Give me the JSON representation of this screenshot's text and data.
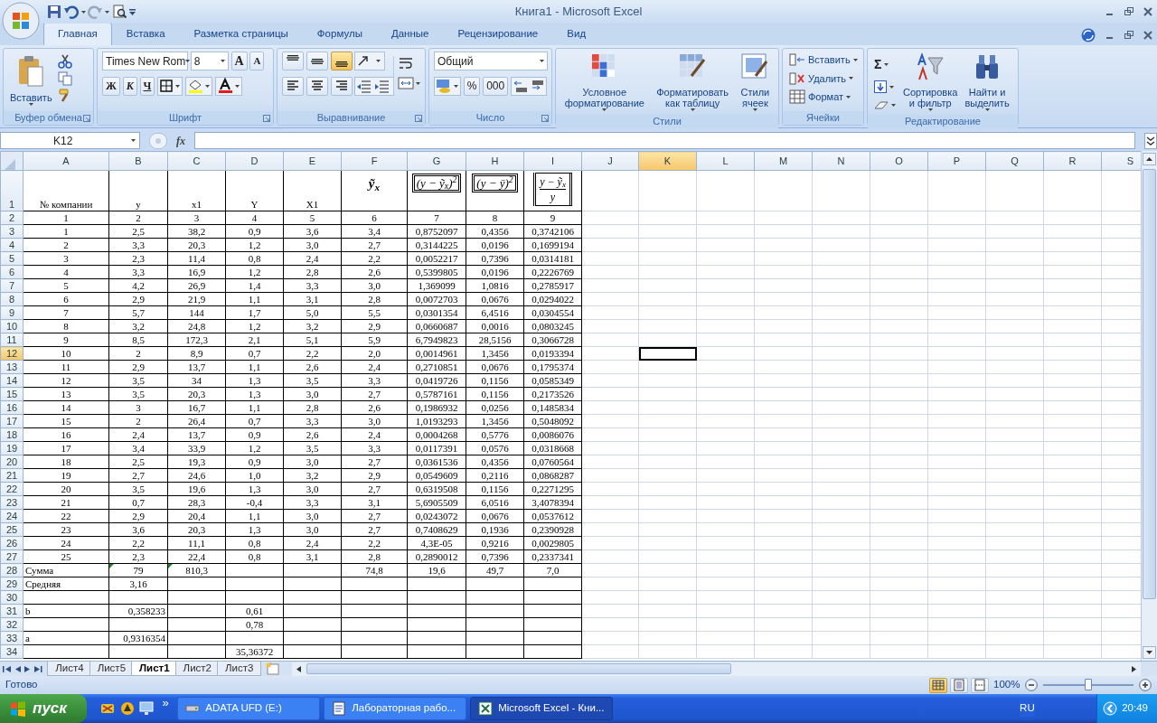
{
  "window": {
    "title": "Книга1 - Microsoft Excel"
  },
  "tabs": [
    {
      "label": "Главная",
      "selected": true
    },
    {
      "label": "Вставка",
      "selected": false
    },
    {
      "label": "Разметка страницы",
      "selected": false
    },
    {
      "label": "Формулы",
      "selected": false
    },
    {
      "label": "Данные",
      "selected": false
    },
    {
      "label": "Рецензирование",
      "selected": false
    },
    {
      "label": "Вид",
      "selected": false
    }
  ],
  "ribbon": {
    "groups": [
      {
        "kind": "clipboard",
        "label": "Буфер обмена",
        "paste": "Вставить"
      },
      {
        "kind": "font",
        "label": "Шрифт",
        "font_name": "Times New Rom",
        "font_size": "8",
        "grow": "A",
        "shrink": "A",
        "bold": "Ж",
        "italic": "К",
        "underline": "Ч"
      },
      {
        "kind": "alignment",
        "label": "Выравнивание",
        "vertical_align": [
          {
            "selected": false
          },
          {
            "selected": false
          },
          {
            "selected": true
          }
        ]
      },
      {
        "kind": "number",
        "label": "Число",
        "format": "Общий",
        "percent": "%",
        "thousands": "000"
      },
      {
        "kind": "styles",
        "label": "Стили",
        "buttons": [
          {
            "lines": [
              "Условное",
              "форматирование"
            ]
          },
          {
            "lines": [
              "Форматировать",
              "как таблицу"
            ]
          },
          {
            "lines": [
              "Стили",
              "ячеек"
            ]
          }
        ]
      },
      {
        "kind": "cells",
        "label": "Ячейки",
        "buttons": [
          "Вставить",
          "Удалить",
          "Формат"
        ]
      },
      {
        "kind": "editing",
        "label": "Редактирование",
        "sum": "Σ",
        "buttons": [
          {
            "lines": [
              "Сортировка",
              "и фильтр"
            ]
          },
          {
            "lines": [
              "Найти и",
              "выделить"
            ]
          }
        ]
      }
    ]
  },
  "formula_bar": {
    "name_box": "K12",
    "fx": "fx"
  },
  "columns": [
    {
      "letter": "A",
      "selected": false
    },
    {
      "letter": "B",
      "selected": false
    },
    {
      "letter": "C",
      "selected": false
    },
    {
      "letter": "D",
      "selected": false
    },
    {
      "letter": "E",
      "selected": false
    },
    {
      "letter": "F",
      "selected": false
    },
    {
      "letter": "G",
      "selected": false
    },
    {
      "letter": "H",
      "selected": false
    },
    {
      "letter": "I",
      "selected": false
    },
    {
      "letter": "J",
      "selected": false
    },
    {
      "letter": "K",
      "selected": true
    },
    {
      "letter": "L",
      "selected": false
    },
    {
      "letter": "M",
      "selected": false
    },
    {
      "letter": "N",
      "selected": false
    },
    {
      "letter": "O",
      "selected": false
    },
    {
      "letter": "P",
      "selected": false
    },
    {
      "letter": "Q",
      "selected": false
    },
    {
      "letter": "R",
      "selected": false
    },
    {
      "letter": "S",
      "selected": false
    }
  ],
  "header_row": {
    "number": "1",
    "selected": false,
    "cells": [
      {
        "kind": "text",
        "text": "№ компании"
      },
      {
        "kind": "text",
        "text": "y"
      },
      {
        "kind": "text",
        "text": "x1"
      },
      {
        "kind": "text",
        "text": "Y"
      },
      {
        "kind": "text",
        "text": "X1"
      },
      {
        "kind": "formula",
        "text": "ỹ$_{x}$"
      },
      {
        "kind": "boxed",
        "text": "(y − ỹ$_{x}$)$^{2}$"
      },
      {
        "kind": "boxed",
        "text": "(y − ȳ)$^{2}$"
      },
      {
        "kind": "fraction",
        "numerator": "y − ỹ$_{x}$",
        "denominator": "y"
      }
    ]
  },
  "rows": [
    {
      "number": "2",
      "selected": false,
      "cells": [
        "1",
        "2",
        "3",
        "4",
        "5",
        "6",
        "7",
        "8",
        "9"
      ]
    },
    {
      "number": "3",
      "selected": false,
      "cells": [
        "1",
        "2,5",
        "38,2",
        "0,9",
        "3,6",
        "3,4",
        "0,8752097",
        "0,4356",
        "0,3742106"
      ]
    },
    {
      "number": "4",
      "selected": false,
      "cells": [
        "2",
        "3,3",
        "20,3",
        "1,2",
        "3,0",
        "2,7",
        "0,3144225",
        "0,0196",
        "0,1699194"
      ]
    },
    {
      "number": "5",
      "selected": false,
      "cells": [
        "3",
        "2,3",
        "11,4",
        "0,8",
        "2,4",
        "2,2",
        "0,0052217",
        "0,7396",
        "0,0314181"
      ]
    },
    {
      "number": "6",
      "selected": false,
      "cells": [
        "4",
        "3,3",
        "16,9",
        "1,2",
        "2,8",
        "2,6",
        "0,5399805",
        "0,0196",
        "0,2226769"
      ]
    },
    {
      "number": "7",
      "selected": false,
      "cells": [
        "5",
        "4,2",
        "26,9",
        "1,4",
        "3,3",
        "3,0",
        "1,369099",
        "1,0816",
        "0,2785917"
      ]
    },
    {
      "number": "8",
      "selected": false,
      "cells": [
        "6",
        "2,9",
        "21,9",
        "1,1",
        "3,1",
        "2,8",
        "0,0072703",
        "0,0676",
        "0,0294022"
      ]
    },
    {
      "number": "9",
      "selected": false,
      "cells": [
        "7",
        "5,7",
        "144",
        "1,7",
        "5,0",
        "5,5",
        "0,0301354",
        "6,4516",
        "0,0304554"
      ]
    },
    {
      "number": "10",
      "selected": false,
      "cells": [
        "8",
        "3,2",
        "24,8",
        "1,2",
        "3,2",
        "2,9",
        "0,0660687",
        "0,0016",
        "0,0803245"
      ]
    },
    {
      "number": "11",
      "selected": false,
      "cells": [
        "9",
        "8,5",
        "172,3",
        "2,1",
        "5,1",
        "5,9",
        "6,7949823",
        "28,5156",
        "0,3066728"
      ]
    },
    {
      "number": "12",
      "selected": true,
      "cells": [
        "10",
        "2",
        "8,9",
        "0,7",
        "2,2",
        "2,0",
        "0,0014961",
        "1,3456",
        "0,0193394"
      ]
    },
    {
      "number": "13",
      "selected": false,
      "cells": [
        "11",
        "2,9",
        "13,7",
        "1,1",
        "2,6",
        "2,4",
        "0,2710851",
        "0,0676",
        "0,1795374"
      ]
    },
    {
      "number": "14",
      "selected": false,
      "cells": [
        "12",
        "3,5",
        "34",
        "1,3",
        "3,5",
        "3,3",
        "0,0419726",
        "0,1156",
        "0,0585349"
      ]
    },
    {
      "number": "15",
      "selected": false,
      "cells": [
        "13",
        "3,5",
        "20,3",
        "1,3",
        "3,0",
        "2,7",
        "0,5787161",
        "0,1156",
        "0,2173526"
      ]
    },
    {
      "number": "16",
      "selected": false,
      "cells": [
        "14",
        "3",
        "16,7",
        "1,1",
        "2,8",
        "2,6",
        "0,1986932",
        "0,0256",
        "0,1485834"
      ]
    },
    {
      "number": "17",
      "selected": false,
      "cells": [
        "15",
        "2",
        "26,4",
        "0,7",
        "3,3",
        "3,0",
        "1,0193293",
        "1,3456",
        "0,5048092"
      ]
    },
    {
      "number": "18",
      "selected": false,
      "cells": [
        "16",
        "2,4",
        "13,7",
        "0,9",
        "2,6",
        "2,4",
        "0,0004268",
        "0,5776",
        "0,0086076"
      ]
    },
    {
      "number": "19",
      "selected": false,
      "cells": [
        "17",
        "3,4",
        "33,9",
        "1,2",
        "3,5",
        "3,3",
        "0,0117391",
        "0,0576",
        "0,0318668"
      ]
    },
    {
      "number": "20",
      "selected": false,
      "cells": [
        "18",
        "2,5",
        "19,3",
        "0,9",
        "3,0",
        "2,7",
        "0,0361536",
        "0,4356",
        "0,0760564"
      ]
    },
    {
      "number": "21",
      "selected": false,
      "cells": [
        "19",
        "2,7",
        "24,6",
        "1,0",
        "3,2",
        "2,9",
        "0,0549609",
        "0,2116",
        "0,0868287"
      ]
    },
    {
      "number": "22",
      "selected": false,
      "cells": [
        "20",
        "3,5",
        "19,6",
        "1,3",
        "3,0",
        "2,7",
        "0,6319508",
        "0,1156",
        "0,2271295"
      ]
    },
    {
      "number": "23",
      "selected": false,
      "cells": [
        "21",
        "0,7",
        "28,3",
        "-0,4",
        "3,3",
        "3,1",
        "5,6905509",
        "6,0516",
        "3,4078394"
      ]
    },
    {
      "number": "24",
      "selected": false,
      "cells": [
        "22",
        "2,9",
        "20,4",
        "1,1",
        "3,0",
        "2,7",
        "0,0243072",
        "0,0676",
        "0,0537612"
      ]
    },
    {
      "number": "25",
      "selected": false,
      "cells": [
        "23",
        "3,6",
        "20,3",
        "1,3",
        "3,0",
        "2,7",
        "0,7408629",
        "0,1936",
        "0,2390928"
      ]
    },
    {
      "number": "26",
      "selected": false,
      "cells": [
        "24",
        "2,2",
        "11,1",
        "0,8",
        "2,4",
        "2,2",
        "4,3E-05",
        "0,9216",
        "0,0029805"
      ]
    },
    {
      "number": "27",
      "selected": false,
      "cells": [
        "25",
        "2,3",
        "22,4",
        "0,8",
        "3,1",
        "2,8",
        "0,2890012",
        "0,7396",
        "0,2337341"
      ]
    },
    {
      "number": "28",
      "selected": false,
      "cells": [
        "Сумма",
        {
          "text": "79",
          "flagged": true
        },
        {
          "text": "810,3",
          "flagged": true
        },
        null,
        null,
        "74,8",
        "19,6",
        "49,7",
        "7,0"
      ]
    },
    {
      "number": "29",
      "selected": false,
      "cells": [
        "Средняя",
        "3,16"
      ]
    },
    {
      "number": "30",
      "selected": false,
      "cells": []
    },
    {
      "number": "31",
      "selected": false,
      "cells": [
        "b",
        "0,358233",
        null,
        "0,61"
      ]
    },
    {
      "number": "32",
      "selected": false,
      "cells": [
        null,
        null,
        null,
        "0,78"
      ]
    },
    {
      "number": "33",
      "selected": false,
      "cells": [
        "a",
        "0,9316354"
      ]
    },
    {
      "number": "34",
      "selected": false,
      "cells": [
        null,
        null,
        null,
        "35,36372"
      ]
    }
  ],
  "sheet_tabs": [
    {
      "label": "Лист4",
      "selected": false
    },
    {
      "label": "Лист5",
      "selected": false
    },
    {
      "label": "Лист1",
      "selected": true
    },
    {
      "label": "Лист2",
      "selected": false
    },
    {
      "label": "Лист3",
      "selected": false
    }
  ],
  "status_bar": {
    "text": "Готово",
    "views": [
      {
        "selected": true
      },
      {
        "selected": false
      },
      {
        "selected": false
      }
    ],
    "zoom": "100%",
    "zoom_slider": {
      "level": 0.5
    }
  },
  "taskbar": {
    "start": "пуск",
    "more": "»",
    "tasks": [
      {
        "label": "ADATA UFD (E:)",
        "selected": false
      },
      {
        "label": "Лабораторная рабо...",
        "selected": false
      },
      {
        "label": "Microsoft Excel - Кни...",
        "selected": true
      }
    ],
    "language": "RU",
    "time": "20:49"
  }
}
